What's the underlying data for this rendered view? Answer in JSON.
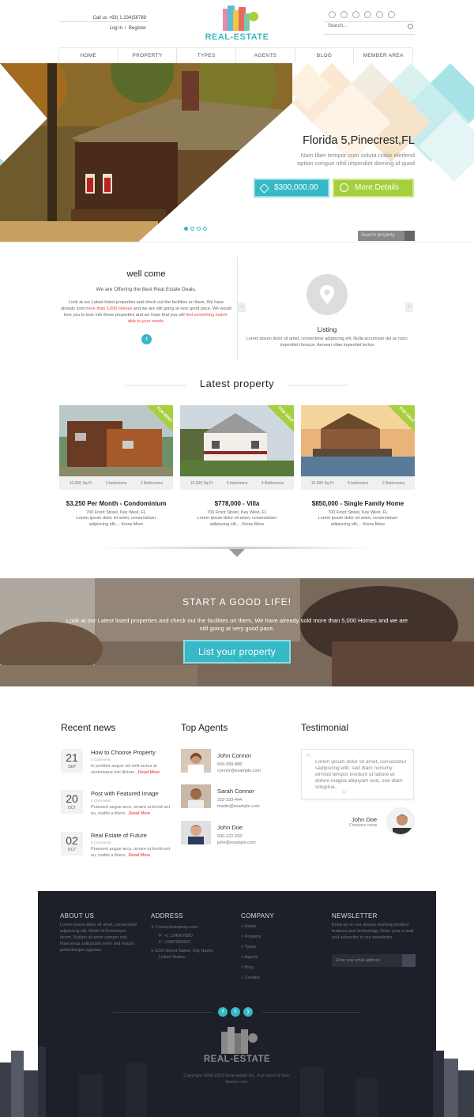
{
  "header": {
    "call": "Call us +63( 1 234)56789",
    "login": "Log in",
    "slash": "/",
    "register": "Register",
    "logo_text": "REAL-ESTATE",
    "search_placeholder": "Search..."
  },
  "nav": [
    "HOME",
    "PROPERTY",
    "TYPES",
    "AGENTS",
    "BLOG",
    "MEMBER AREA"
  ],
  "hero": {
    "title": "Florida 5,Pinecrest,FL",
    "subtitle_line1": "Nam liber tempor cum soluta nobis eleifend",
    "subtitle_line2": "option congue nihil imperdiet doming id quod",
    "price": "$300,000.00",
    "more": "More Details",
    "search_property": "Search property",
    "slides_total": 4,
    "slide_active": 1
  },
  "welcome": {
    "title": "well come",
    "subtitle": "We are Offering the Best Real Estate Deals.",
    "text_a": "Look at our Latest listed properties and check out the facilities on them, We have already sold ",
    "text_red1": "more than 5,000 Homes",
    "text_b": " and we are still going at very good pace. We would love you to look into these properties and we hope that you will ",
    "text_red2": "find something match-able to your needs.",
    "listing_title": "Listing",
    "listing_text": "Lorem ipsum dolor sit amet, consectetur adipiscing elit. Nulla accumsan dui ac nunc imperdiet rhoncus. Aenean vitae imperdiet lectus"
  },
  "latest": {
    "title": "Latest property",
    "cards": [
      {
        "ribbon": "FOR RENT",
        "area": "10,000 Sq Ft",
        "beds": "3 bedrooms",
        "baths": "2 Bathrooms",
        "title": "$3,250 Per Month - Condominium",
        "address": "700 Front Street, Key West, FL",
        "desc1": "Lorem ipsum dolor sit amet, consectetuer",
        "desc2": "adipiscing elit,... Know More"
      },
      {
        "ribbon": "FOR SALE",
        "area": "10,000 Sq Ft",
        "beds": "5 bedrooms",
        "baths": "4 Bathrooms",
        "title": "$778,000 - Villa",
        "address": "700 Front Street, Key West, FL",
        "desc1": "Lorem ipsum dolor sit amet, consectetuer",
        "desc2": "adipiscing elit,... Know More"
      },
      {
        "ribbon": "FOR SALE",
        "area": "10,000 Sq Ft",
        "beds": "4 bedrooms",
        "baths": "2 Bathrooms",
        "title": "$850,000 - Single Family Home",
        "address": "700 Front Street, Key West, FL",
        "desc1": "Lorem ipsum dolor sit amet, consectetuer",
        "desc2": "adipiscing elit,... Know More"
      }
    ]
  },
  "banner": {
    "title": "START A GOOD LIFE!",
    "text": "Look at our Latest listed properties and check out the facilities on them, We have already sold more than 5,000 Homes and we are still going at very good pace.",
    "button": "List your property"
  },
  "news": {
    "title": "Recent news",
    "items": [
      {
        "day": "21",
        "month": "SEP",
        "title": "How to Choose Property",
        "comments": "2 Comments",
        "text": "In porttitor augue vel velit luctus at scelerisque nisi dictum...",
        "more": "Read More"
      },
      {
        "day": "20",
        "month": "OCT",
        "title": "Post with Featured Image",
        "comments": "2 Comments",
        "text": "Praesent augue arcu, ornare ut tincid-unt eu, mattis a libero...",
        "more": "Read More"
      },
      {
        "day": "02",
        "month": "OCT",
        "title": "Real Estate of Future",
        "comments": "6 Comments",
        "text": "Praesent augue arcu, ornare ut tincid-unt eu, mattis a libero...",
        "more": "Read More"
      }
    ]
  },
  "agents": {
    "title": "Top Agents",
    "items": [
      {
        "name": "John Connor",
        "phone": "666-999-888",
        "email": "connor@example.com"
      },
      {
        "name": "Sarah Connor",
        "phone": "222-333-444",
        "email": "martin@example.com"
      },
      {
        "name": "John Doe",
        "phone": "000-222-333",
        "email": "john@example.com"
      }
    ]
  },
  "testimonial": {
    "title": "Testimonial",
    "quote": "Lorem ipsum dolor sit amet, consectetur sadipscing elitr, sed diam nonumy eirmod tempor invidunt ut labore et dolore magna aliquyam erat, sed diam voluptua.",
    "name": "John Doe",
    "role": "Company name"
  },
  "footer": {
    "about_title": "ABOUT US",
    "about_text": "Lorem ipsum dolor sit amet, consectetur adipiscing elit. Morbi id fermentum lorem. Nullam sit amet semper nisi. Maecenas sollicitudin enim sed mauris pellentesque egestas.",
    "address_title": "ADDRESS",
    "email": "Contactcompany.com",
    "phone": "P: +1 23456789D",
    "fax": "F: +0987654321",
    "addr1": "1234 Street Name, City Name,",
    "addr2": "United States.",
    "company_title": "COMPANY",
    "company_links": [
      "> Home",
      "> Property",
      "> Types",
      "> Agents",
      "> Blog",
      "> Contact"
    ],
    "newsletter_title": "NEWSLETTER",
    "newsletter_text": "Keep up on our always evolving product features and technology. Enter your e-mail and subscribe to our newsletter.",
    "newsletter_placeholder": "Enter your email address",
    "logo_text": "REAL-ESTATE",
    "copyright": "Copyright 2008-2013 Real-estate Inc. A product of Noo-theme.com."
  },
  "colors": {
    "accent": "#36b8c6",
    "green": "#a6cf3d",
    "footer_bg": "#1d2029",
    "red_link": "#e44444"
  }
}
